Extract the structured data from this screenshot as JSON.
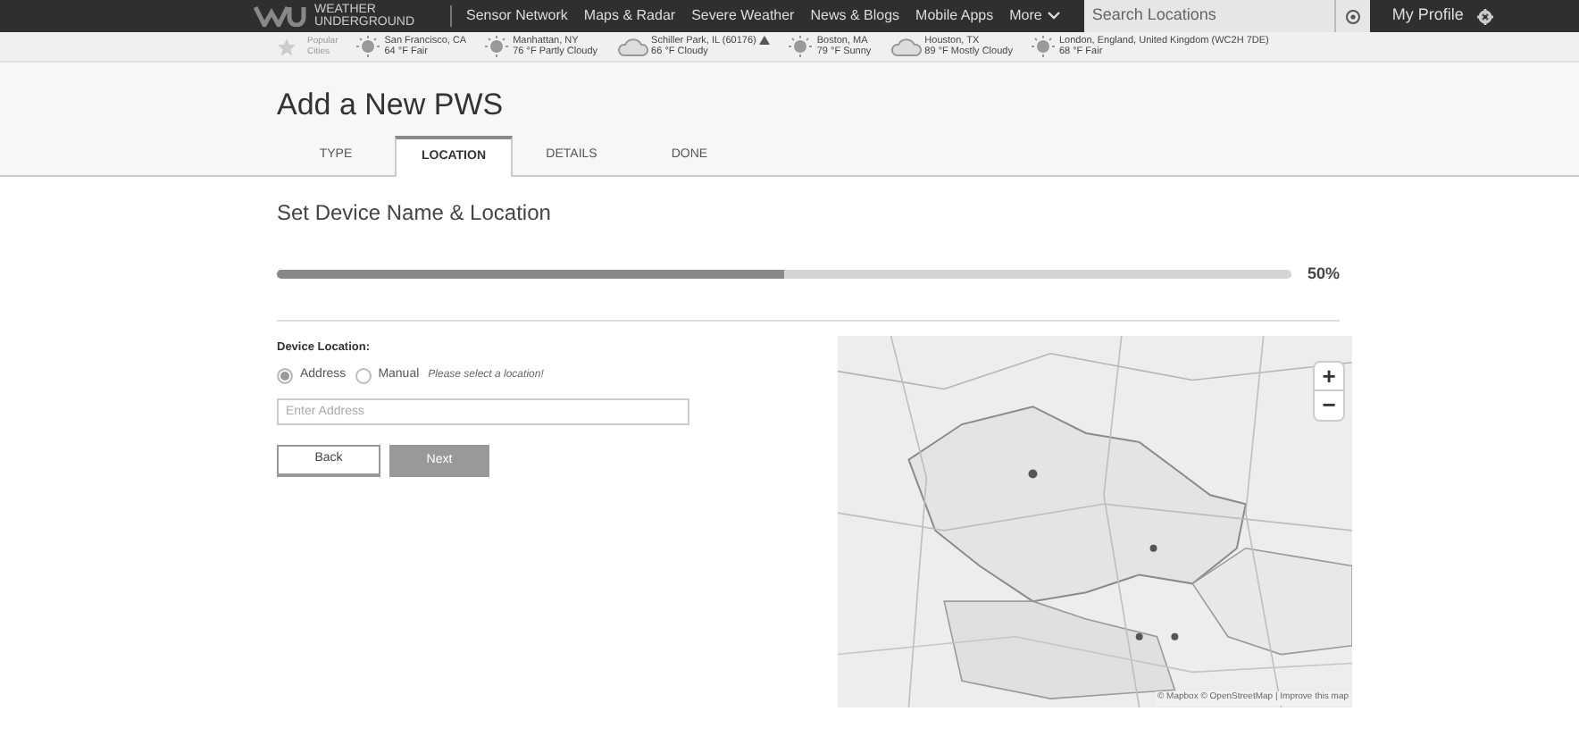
{
  "nav": {
    "logo_line1": "WEATHER",
    "logo_line2": "UNDERGROUND",
    "links": [
      "Sensor Network",
      "Maps & Radar",
      "Severe Weather",
      "News & Blogs",
      "Mobile Apps",
      "More"
    ],
    "search": {
      "placeholder": "Search Locations"
    },
    "profile": "My Profile"
  },
  "cities_label": {
    "line1": "Popular",
    "line2": "Cities"
  },
  "cities": [
    {
      "name": "San Francisco, CA",
      "weather": "64 °F Fair",
      "kind": "sun",
      "alert": false
    },
    {
      "name": "Manhattan, NY",
      "weather": "76 °F Partly Cloudy",
      "kind": "sun",
      "alert": false
    },
    {
      "name": "Schiller Park, IL (60176)",
      "weather": "66 °F Cloudy",
      "kind": "cloud",
      "alert": true
    },
    {
      "name": "Boston, MA",
      "weather": "79 °F Sunny",
      "kind": "sun",
      "alert": false
    },
    {
      "name": "Houston, TX",
      "weather": "89 °F Mostly Cloudy",
      "kind": "cloud",
      "alert": false
    },
    {
      "name": "London, England, United Kingdom (WC2H 7DE)",
      "weather": "68 °F Fair",
      "kind": "sun",
      "alert": false
    }
  ],
  "page_title": "Add a New PWS",
  "tabs": [
    {
      "label": "TYPE",
      "selected": false
    },
    {
      "label": "LOCATION",
      "selected": true
    },
    {
      "label": "DETAILS",
      "selected": false
    },
    {
      "label": "DONE",
      "selected": false
    }
  ],
  "section_title": "Set Device Name & Location",
  "progress": {
    "level": 0.5,
    "reading": "50%"
  },
  "form": {
    "label": "Device Location:",
    "options": [
      {
        "label": "Address",
        "selected": true
      },
      {
        "label": "Manual",
        "selected": false
      }
    ],
    "hint": "Please select a location!",
    "address": {
      "placeholder": "Enter Address"
    },
    "back": "Back",
    "next": "Next"
  },
  "map": {
    "kind": "picture",
    "zoom_in": "+",
    "zoom_out": "−",
    "attribution": "© Mapbox © OpenStreetMap | Improve this map"
  }
}
